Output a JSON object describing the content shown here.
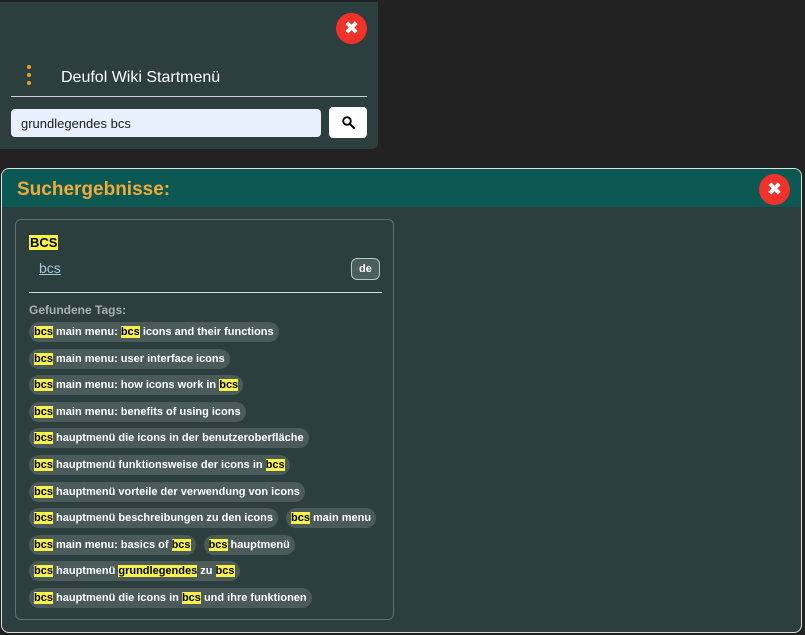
{
  "menu": {
    "title": "Deufol Wiki Startmenü",
    "search_value": "grundlegendes bcs",
    "search_placeholder": "",
    "close_icon": "close-icon",
    "accent_color": "#e8a21f"
  },
  "results": {
    "title": "Suchergebnisse:",
    "card": {
      "title": "BCS",
      "link": "bcs",
      "lang": "de",
      "tags_heading": "Gefundene Tags:",
      "tag_rows": [
        [
          [
            {
              "t": "bcs",
              "h": true
            },
            {
              "t": " main menu: "
            },
            {
              "t": "bcs",
              "h": true
            },
            {
              "t": " icons and their functions"
            }
          ]
        ],
        [
          [
            {
              "t": "bcs",
              "h": true
            },
            {
              "t": " main menu: user interface icons"
            }
          ]
        ],
        [
          [
            {
              "t": "bcs",
              "h": true
            },
            {
              "t": " main menu: how icons work in "
            },
            {
              "t": "bcs",
              "h": true
            }
          ]
        ],
        [
          [
            {
              "t": "bcs",
              "h": true
            },
            {
              "t": " main menu: benefits of using icons"
            }
          ]
        ],
        [
          [
            {
              "t": "bcs",
              "h": true
            },
            {
              "t": " hauptmenü die icons in der benutzeroberfläche"
            }
          ]
        ],
        [
          [
            {
              "t": "bcs",
              "h": true
            },
            {
              "t": " hauptmenü funktionsweise der icons in "
            },
            {
              "t": "bcs",
              "h": true
            }
          ]
        ],
        [
          [
            {
              "t": "bcs",
              "h": true
            },
            {
              "t": " hauptmenü vorteile der verwendung von icons"
            }
          ]
        ],
        [
          [
            {
              "t": "bcs",
              "h": true
            },
            {
              "t": " hauptmenü beschreibungen zu den icons"
            }
          ],
          [
            {
              "t": "bcs",
              "h": true
            },
            {
              "t": " main menu"
            }
          ]
        ],
        [
          [
            {
              "t": "bcs",
              "h": true
            },
            {
              "t": " main menu: basics of "
            },
            {
              "t": "bcs",
              "h": true
            }
          ],
          [
            {
              "t": "bcs",
              "h": true
            },
            {
              "t": " hauptmenü"
            }
          ]
        ],
        [
          [
            {
              "t": "bcs",
              "h": true
            },
            {
              "t": " hauptmenü "
            },
            {
              "t": "grundlegendes",
              "h": true
            },
            {
              "t": " zu "
            },
            {
              "t": "bcs",
              "h": true
            }
          ]
        ],
        [
          [
            {
              "t": "bcs",
              "h": true
            },
            {
              "t": " hauptmenü die icons in "
            },
            {
              "t": "bcs",
              "h": true
            },
            {
              "t": " und ihre funktionen"
            }
          ]
        ]
      ]
    }
  },
  "colors": {
    "highlight": "#f7f249",
    "close_button": "#f0322b",
    "header_bg": "#0c5954",
    "title_orange": "#f2a93b"
  }
}
